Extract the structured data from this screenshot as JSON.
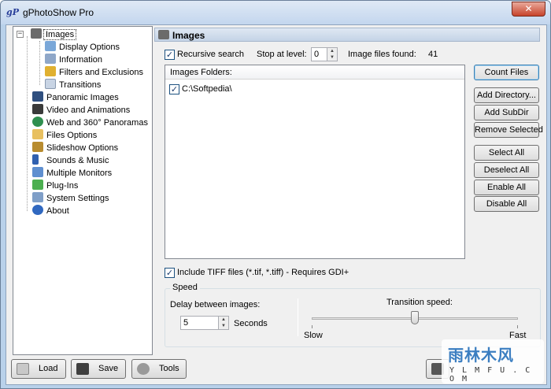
{
  "window": {
    "title": "gPhotoShow Pro",
    "app_icon": "gP",
    "close_glyph": "✕"
  },
  "tree": {
    "expander_glyph": "−",
    "items": [
      {
        "label": "Images",
        "icon": "camera-icon",
        "color": "#6b6b6b"
      },
      {
        "label": "Display Options",
        "icon": "monitor-icon",
        "color": "#7aa7d8"
      },
      {
        "label": "Information",
        "icon": "info-window-icon",
        "color": "#8fa7c8"
      },
      {
        "label": "Filters and Exclusions",
        "icon": "filter-icon",
        "color": "#e0b030"
      },
      {
        "label": "Transitions",
        "icon": "document-icon",
        "color": "#c8d4e4"
      },
      {
        "label": "Panoramic Images",
        "icon": "panorama-icon",
        "color": "#2f4f7f"
      },
      {
        "label": "Video and Animations",
        "icon": "film-icon",
        "color": "#3a3a3a"
      },
      {
        "label": "Web and 360° Panoramas",
        "icon": "globe-icon",
        "color": "#2f8f4f"
      },
      {
        "label": "Files Options",
        "icon": "folder-icon",
        "color": "#e8c060"
      },
      {
        "label": "Slideshow Options",
        "icon": "wrench-icon",
        "color": "#b88c30"
      },
      {
        "label": "Sounds & Music",
        "icon": "music-note-icon",
        "color": "#3060b0"
      },
      {
        "label": "Multiple Monitors",
        "icon": "monitors-icon",
        "color": "#5f8fd0"
      },
      {
        "label": "Plug-Ins",
        "icon": "puzzle-icon",
        "color": "#4caf50"
      },
      {
        "label": "System Settings",
        "icon": "settings-window-icon",
        "color": "#7f9fc8"
      },
      {
        "label": "About",
        "icon": "info-icon",
        "color": "#3068c0"
      }
    ]
  },
  "panel": {
    "title": "Images",
    "recursive_search": {
      "label": "Recursive search",
      "checked": true,
      "mark": "✓"
    },
    "stop_at_level": {
      "label": "Stop at level:",
      "value": "0"
    },
    "image_files_found": {
      "label": "Image files found:",
      "value": "41"
    },
    "folders": {
      "header": "Images Folders:",
      "items": [
        {
          "path": "C:\\Softpedia\\",
          "checked": true,
          "mark": "✓"
        }
      ]
    },
    "buttons": {
      "count_files": "Count Files",
      "add_directory": "Add Directory...",
      "add_subdir": "Add SubDir",
      "remove_selected": "Remove Selected",
      "select_all": "Select All",
      "deselect_all": "Deselect All",
      "enable_all": "Enable All",
      "disable_all": "Disable All"
    },
    "include_tiff": {
      "label": "Include TIFF files (*.tif, *.tiff) - Requires GDI+",
      "checked": true,
      "mark": "✓"
    },
    "speed": {
      "title": "Speed",
      "delay_label": "Delay between images:",
      "delay_value": "5",
      "delay_unit": "Seconds",
      "transition_label": "Transition speed:",
      "slow_label": "Slow",
      "fast_label": "Fast",
      "transition_level": 0.5
    }
  },
  "bottom": {
    "load": "Load",
    "save": "Save",
    "tools": "Tools"
  },
  "watermark": {
    "main": "雨林木风",
    "sub": "Y L M F U . C O M"
  },
  "spin": {
    "up": "▲",
    "down": "▼"
  },
  "colors": {
    "accent": "#3c7fb1",
    "title_bar": "#c3d6ee",
    "close": "#c7432b"
  }
}
